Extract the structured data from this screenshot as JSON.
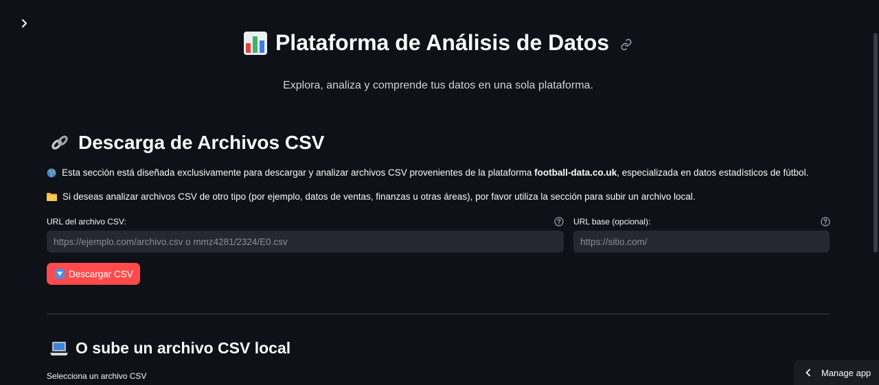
{
  "header": {
    "title": "Plataforma de Análisis de Datos",
    "title_icon": "bar-chart-icon",
    "subtitle": "Explora, analiza y comprende tus datos en una sola plataforma."
  },
  "download_section": {
    "title": "Descarga de Archivos CSV",
    "title_icon": "link-icon",
    "para1_before": "Esta sección está diseñada exclusivamente para descargar y analizar archivos CSV provenientes de la plataforma ",
    "para1_bold": "football-data.co.uk",
    "para1_after": ", especializada en datos estadísticos de fútbol.",
    "para1_icon": "globe-icon",
    "para2": "Si deseas analizar archivos CSV de otro tipo (por ejemplo, datos de ventas, finanzas u otras áreas), por favor utiliza la sección para subir un archivo local.",
    "para2_icon": "folder-icon",
    "url_label": "URL del archivo CSV:",
    "url_placeholder": "https://ejemplo.com/archivo.csv o mmz4281/2324/E0.csv",
    "url_value": "",
    "base_label": "URL base (opcional):",
    "base_placeholder": "https://sitio.com/",
    "base_value": "",
    "button_label": "Descargar CSV",
    "button_icon": "down-arrow-button-icon"
  },
  "upload_section": {
    "title": "O sube un archivo CSV local",
    "title_icon": "laptop-icon",
    "file_label": "Selecciona un archivo CSV"
  },
  "footer": {
    "manage_label": "Manage app"
  },
  "colors": {
    "background": "#0e1117",
    "input_bg": "#262730",
    "primary": "#ff4b4b",
    "text": "#fafafa"
  }
}
